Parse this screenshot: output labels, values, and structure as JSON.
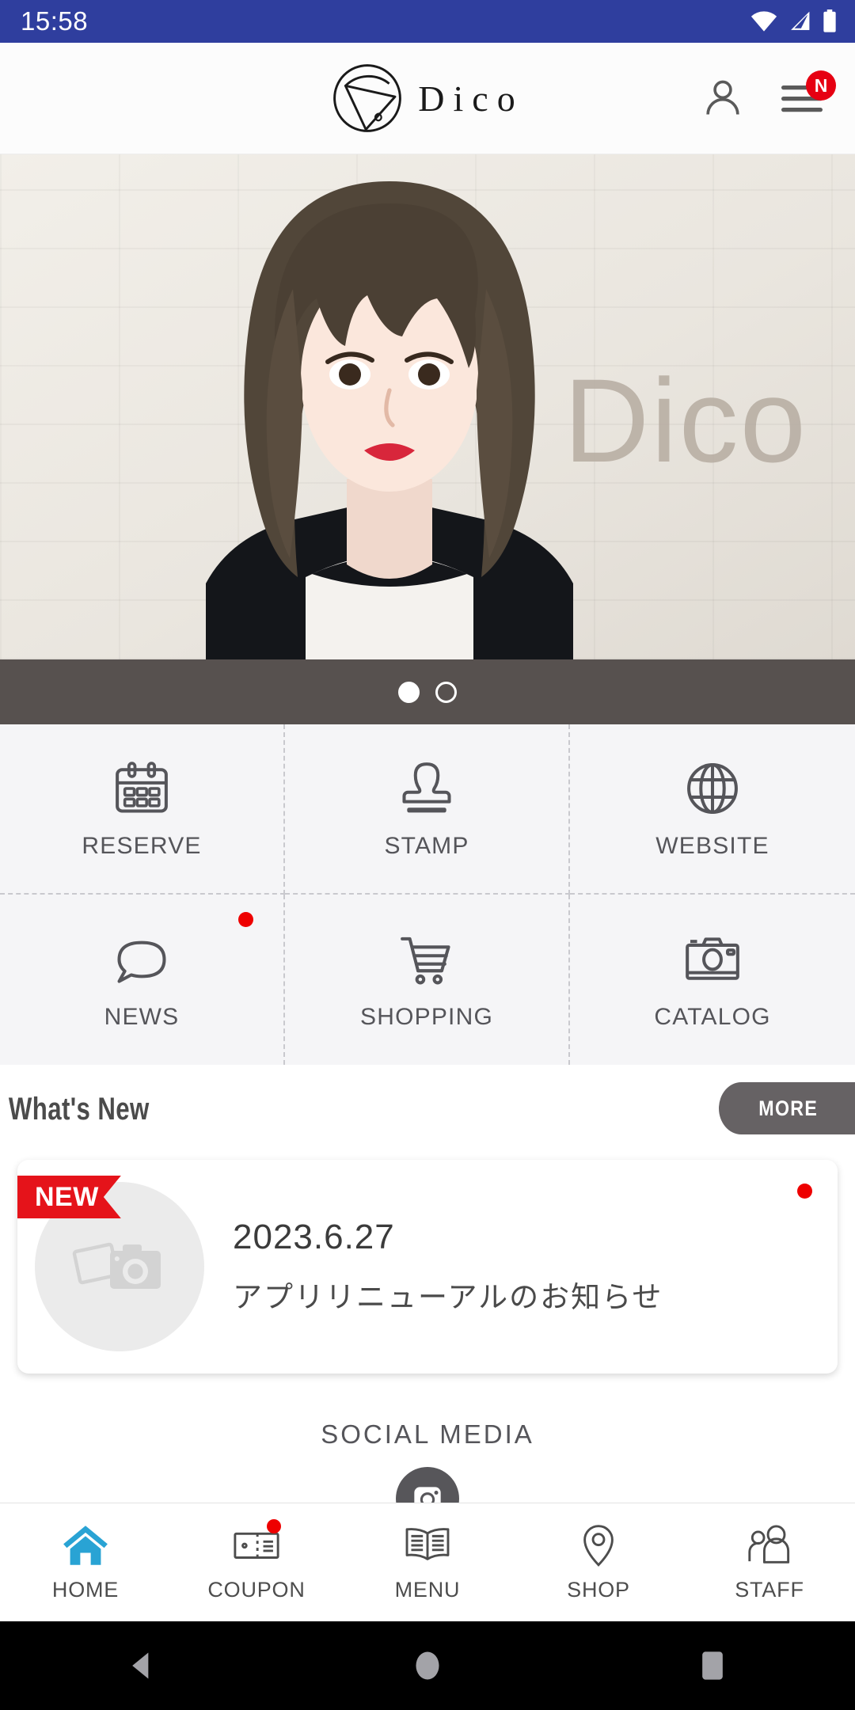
{
  "statusbar": {
    "time": "15:58",
    "icons": [
      "wifi-icon",
      "cellular-signal-icon",
      "battery-icon"
    ]
  },
  "header": {
    "logo_text": "Dico",
    "logo_mark": "dico-circle-triangle-logo",
    "account_icon": "person-icon",
    "menu_icon": "hamburger-menu-icon",
    "menu_badge": "N"
  },
  "hero": {
    "watermark": "Dico",
    "alt": "salon-model-hero-photo"
  },
  "carousel": {
    "total": 2,
    "active_index": 0
  },
  "grid": {
    "items": [
      {
        "label": "RESERVE",
        "icon": "calendar-icon",
        "badge": false
      },
      {
        "label": "STAMP",
        "icon": "stamp-icon",
        "badge": false
      },
      {
        "label": "WEBSITE",
        "icon": "globe-icon",
        "badge": false
      },
      {
        "label": "NEWS",
        "icon": "speech-bubble-icon",
        "badge": true
      },
      {
        "label": "SHOPPING",
        "icon": "shopping-cart-icon",
        "badge": false
      },
      {
        "label": "CATALOG",
        "icon": "camera-icon",
        "badge": false
      }
    ]
  },
  "whats_new": {
    "title": "What's New",
    "more_label": "MORE",
    "card": {
      "ribbon": "NEW",
      "date": "2023.6.27",
      "text": "アプリリニューアルのお知らせ",
      "thumb_icon": "photo-placeholder-icon",
      "unread": true
    }
  },
  "social": {
    "title": "SOCIAL MEDIA",
    "links": [
      {
        "name": "instagram-icon"
      }
    ]
  },
  "bottomnav": {
    "items": [
      {
        "label": "HOME",
        "icon": "home-icon",
        "active": true,
        "badge": false
      },
      {
        "label": "COUPON",
        "icon": "ticket-icon",
        "active": false,
        "badge": true
      },
      {
        "label": "MENU",
        "icon": "open-book-icon",
        "active": false,
        "badge": false
      },
      {
        "label": "SHOP",
        "icon": "map-pin-icon",
        "active": false,
        "badge": false
      },
      {
        "label": "STAFF",
        "icon": "people-icon",
        "active": false,
        "badge": false
      }
    ]
  },
  "androidnav": {
    "buttons": [
      "back-icon",
      "home-icon",
      "recents-icon"
    ]
  },
  "colors": {
    "statusbar": "#2F3E9E",
    "accent_blue": "#29A3D4",
    "badge_red": "#E60012",
    "ribbon_red": "#E5131A",
    "more_gray": "#666264",
    "dots_bar": "#57514F",
    "grid_bg": "#F5F5F7"
  }
}
